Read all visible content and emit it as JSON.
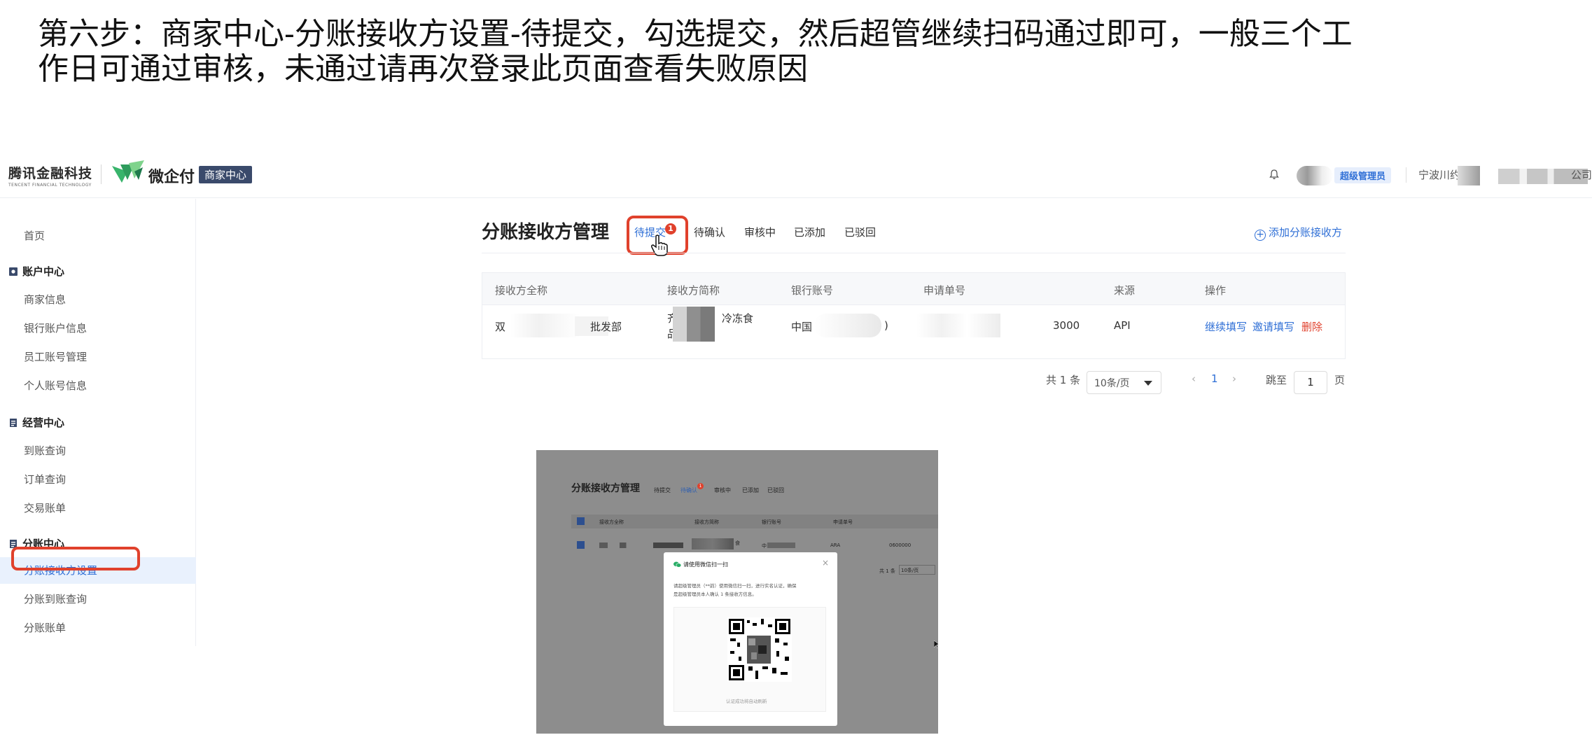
{
  "instruction": {
    "line1": "第六步：商家中心-分账接收方设置-待提交，勾选提交，然后超管继续扫码通过即可，一般三个工",
    "line2": "作日可通过审核，未通过请再次登录此页面查看失败原因"
  },
  "header": {
    "brand_cn": "腾讯金融科技",
    "brand_en": "TENCENT FINANCIAL TECHNOLOGY",
    "product": "微企付",
    "center_badge": "商家中心",
    "role_badge": "超级管理员",
    "company": "宁波川约",
    "company_trail": "公司"
  },
  "sidebar": {
    "home": "首页",
    "groups": [
      {
        "title": "账户中心",
        "items": [
          "商家信息",
          "银行账户信息",
          "员工账号管理",
          "个人账号信息"
        ]
      },
      {
        "title": "经营中心",
        "items": [
          "到账查询",
          "订单查询",
          "交易账单"
        ]
      },
      {
        "title": "分账中心",
        "items": [
          "分账接收方设置",
          "分账到账查询",
          "分账账单"
        ]
      }
    ]
  },
  "main": {
    "title": "分账接收方管理",
    "tabs": [
      "待提交",
      "待确认",
      "审核中",
      "已添加",
      "已驳回"
    ],
    "tab_badge": "1",
    "add_link": "添加分账接收方",
    "columns": [
      "接收方全称",
      "接收方简称",
      "银行账号",
      "申请单号",
      "来源",
      "操作"
    ],
    "row": {
      "full_name_a": "双",
      "full_name_b": "批发部",
      "short_a": "齐",
      "short_b": "冷冻食",
      "short_c": "品",
      "bank_a": "中国",
      "bank_b": ")",
      "apply_no": "3000",
      "source": "API",
      "ops": [
        "继续填写",
        "邀请填写",
        "删除"
      ]
    },
    "pagination": {
      "total": "共 1 条",
      "page_size": "10条/页",
      "current": "1",
      "jump_label": "跳至",
      "jump_value": "1",
      "page_unit": "页"
    }
  },
  "inset": {
    "title": "分账接收方管理",
    "tabs": [
      "待提交",
      "待确认",
      "审核中",
      "已添加",
      "已驳回"
    ],
    "tab_badge": "1",
    "columns": [
      "接收方全称",
      "接收方简称",
      "银行账号",
      "申请单号"
    ],
    "row_source": "ARA",
    "row_no": "0600000",
    "pager_total": "共 1 条",
    "pager_size": "10条/页",
    "modal_title": "请使用微信扫一扫",
    "modal_text_1": "请超级管理员（**韵）使用微信扫一扫，进行实名认证，确保",
    "modal_text_2": "是超级管理员本人确认 1 条接收方信息。",
    "qr_caption": "认证成功将自动刷新",
    "row_bank": "中",
    "row_short": "食"
  },
  "colors": {
    "accent": "#2f6fd6",
    "highlight": "#e0412c",
    "danger": "#e0412c"
  }
}
